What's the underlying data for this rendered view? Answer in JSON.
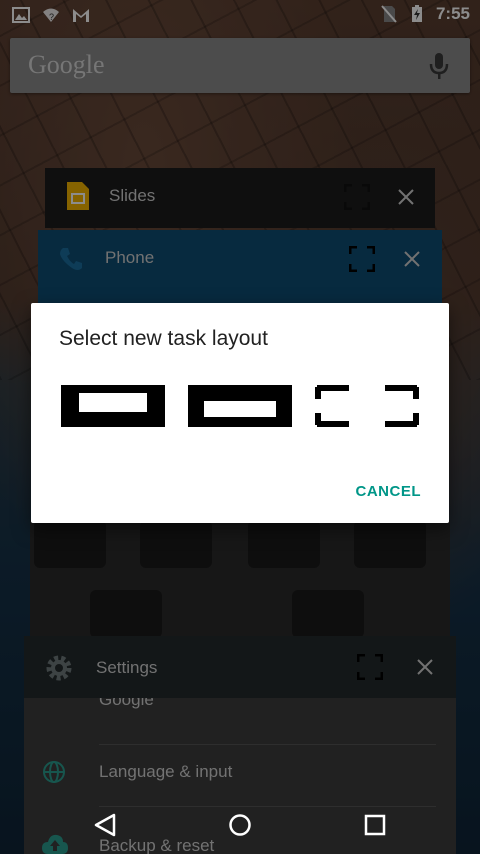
{
  "status_bar": {
    "time": "7:55",
    "icons": [
      "image-icon",
      "wifi-unknown-icon",
      "gmail-icon",
      "no-sim-icon",
      "battery-charging-icon"
    ]
  },
  "search": {
    "logo_text": "Google",
    "mic_icon": "mic-icon"
  },
  "cards": {
    "slides": {
      "title": "Slides",
      "icon": "slides-app-icon",
      "color": "#1d1d1d"
    },
    "phone": {
      "title": "Phone",
      "icon": "phone-app-icon",
      "color": "#0e4d73"
    },
    "settings": {
      "title": "Settings",
      "icon": "gear-icon",
      "rows": [
        {
          "label": "Google",
          "icon": "google-g-icon"
        },
        {
          "label": "Language & input",
          "icon": "globe-icon"
        },
        {
          "label": "Backup & reset",
          "icon": "cloud-upload-icon"
        }
      ]
    }
  },
  "dialog": {
    "title": "Select new task layout",
    "options": [
      "layout-option-1",
      "layout-option-2",
      "layout-option-3"
    ],
    "cancel_label": "CANCEL",
    "accent_color": "#009688"
  },
  "nav": {
    "back": "back-icon",
    "home": "home-icon",
    "recents": "recents-icon"
  }
}
